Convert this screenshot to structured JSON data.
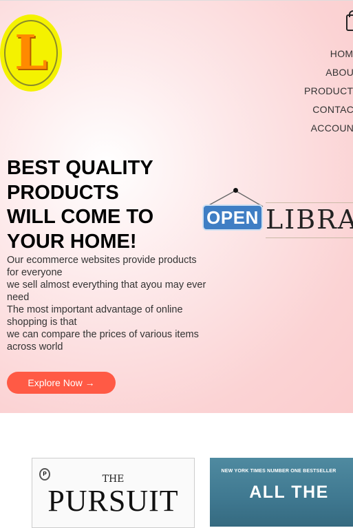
{
  "header": {
    "logo_letter": "L",
    "cart_icon": "shopping-bag-icon",
    "nav": [
      "HOME",
      "ABOUT",
      "PRODUCTS",
      "CONTACT",
      "ACCOUNT"
    ]
  },
  "hero": {
    "headline": [
      "BEST QUALITY",
      "PRODUCTS",
      "WILL COME TO",
      "YOUR HOME!"
    ],
    "description": [
      "Our ecommerce websites provide products for everyone",
      "we sell almost everything that ayou may ever need",
      "The most important advantage of online shopping is that",
      "we can compare the prices of various items across world"
    ],
    "cta_label": "Explore Now →",
    "sign_text": "OPEN",
    "library_text": "LIBRA"
  },
  "books": [
    {
      "pre_title": "THE",
      "title": "PURSUIT"
    },
    {
      "banner": "NEW YORK TIMES NUMBER ONE BESTSELLER",
      "title": "ALL THE"
    }
  ],
  "colors": {
    "cta_bg": "#ff5a45",
    "sign_blue": "#3f7ec4",
    "logo_yellow": "#f4f200",
    "logo_orange": "#ff8a00"
  }
}
